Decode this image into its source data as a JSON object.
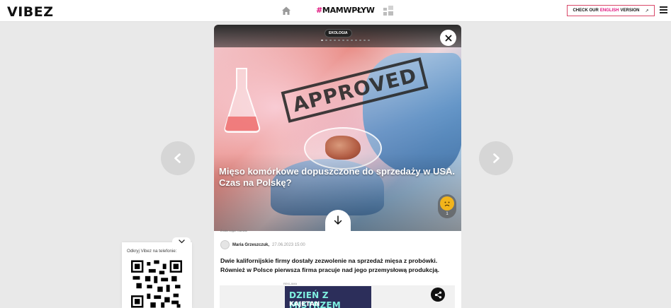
{
  "header": {
    "logo": "VIBEZ",
    "brand_hash": "#",
    "brand_name": "MAMWPŁYW",
    "english": {
      "before": "CHECK OUR",
      "accent": "ENGLISH",
      "after": "VERSION",
      "arrow": "↗"
    }
  },
  "article": {
    "category": "EKOLOGIA",
    "title": "Mięso komórkowe dopuszczone do sprzedaży w USA. Czas na Polskę?",
    "stamp_text": "APPROVED",
    "reaction_count": "1",
    "source": "Źródło zdjęć: Canvas",
    "author": "Maria Grzeszczuk,",
    "date": "27.06.2023 15:00",
    "lead": "Dwie kalifornijskie firmy dostały zezwolenie na sprzedaż mięsa z probówki. Również w Polsce pierwsza firma pracuje nad jego przemysłową produkcją.",
    "ad_label": "REKLAMA",
    "ad_line1": "DZIEŃ Z MISTRZEM",
    "ad_line2": "KAJETAN"
  },
  "qr_panel": {
    "text": "Odkryj Vibez na telefonie:"
  },
  "colors": {
    "accent": "#e0147e",
    "ad_bg": "#2c2e5a",
    "ad_text": "#7ff0e0",
    "reaction": "#f2b41b"
  },
  "icons": [
    "home-icon",
    "grid-icon",
    "menu-icon",
    "chevron-left-icon",
    "chevron-right-icon",
    "close-icon",
    "arrow-down-icon",
    "sad-face-icon",
    "share-icon",
    "chevron-down-icon",
    "qr-code"
  ]
}
